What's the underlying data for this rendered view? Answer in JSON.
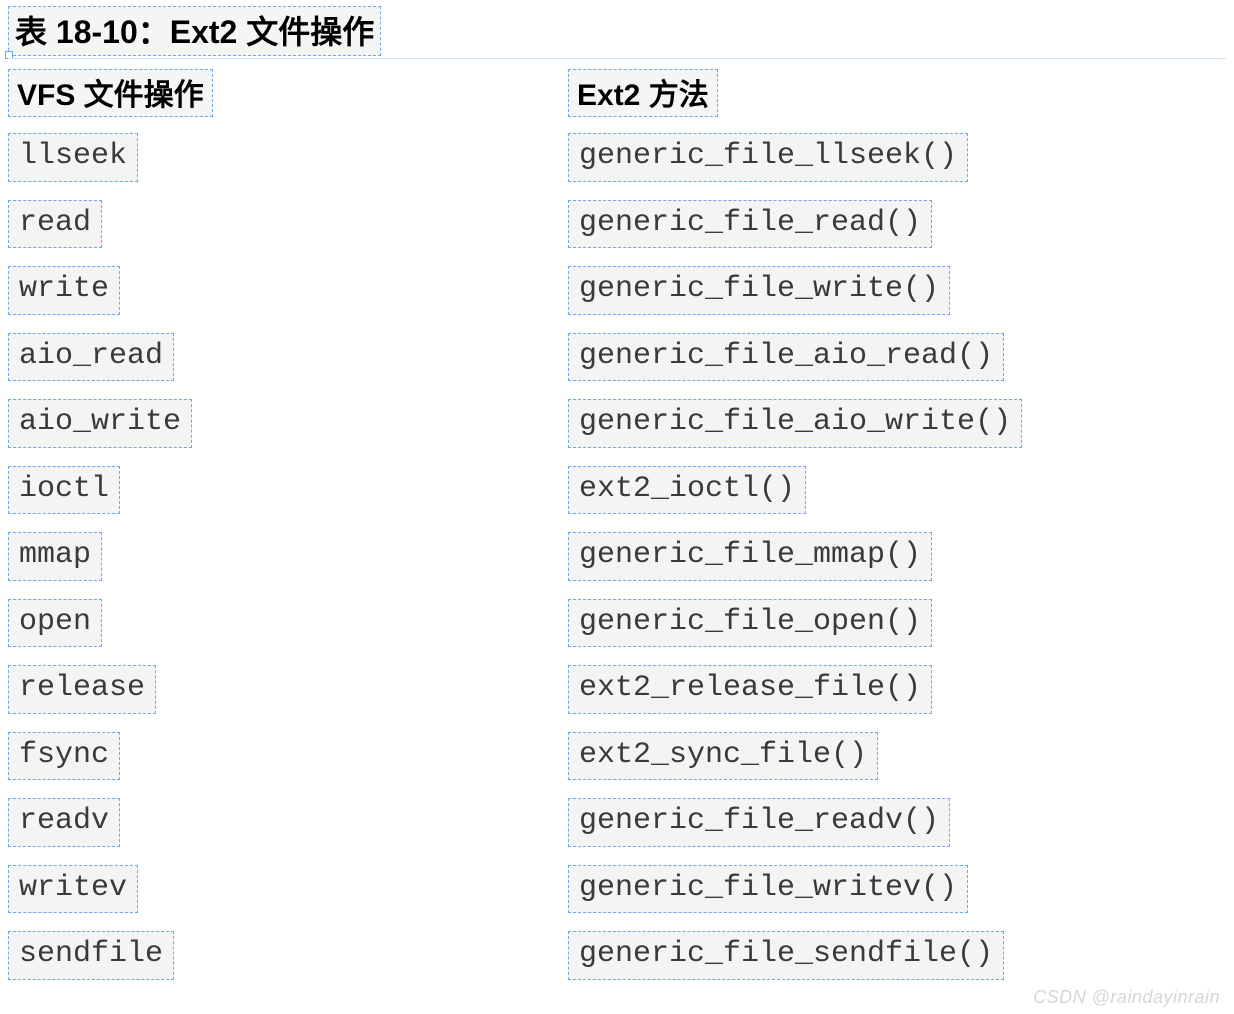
{
  "title": "表 18-10：Ext2 文件操作",
  "columns": {
    "left_header": "VFS 文件操作",
    "right_header": "Ext2 方法"
  },
  "rows": [
    {
      "vfs": "llseek",
      "ext2": "generic_file_llseek()"
    },
    {
      "vfs": "read",
      "ext2": "generic_file_read()"
    },
    {
      "vfs": "write",
      "ext2": "generic_file_write()"
    },
    {
      "vfs": "aio_read",
      "ext2": "generic_file_aio_read()"
    },
    {
      "vfs": "aio_write",
      "ext2": "generic_file_aio_write()"
    },
    {
      "vfs": "ioctl",
      "ext2": "ext2_ioctl()"
    },
    {
      "vfs": "mmap",
      "ext2": "generic_file_mmap()"
    },
    {
      "vfs": "open",
      "ext2": "generic_file_open()"
    },
    {
      "vfs": "release",
      "ext2": "ext2_release_file()"
    },
    {
      "vfs": "fsync",
      "ext2": "ext2_sync_file()"
    },
    {
      "vfs": "readv",
      "ext2": "generic_file_readv()"
    },
    {
      "vfs": "writev",
      "ext2": "generic_file_writev()"
    },
    {
      "vfs": "sendfile",
      "ext2": "generic_file_sendfile()"
    }
  ],
  "watermark": "CSDN @raindayinrain"
}
